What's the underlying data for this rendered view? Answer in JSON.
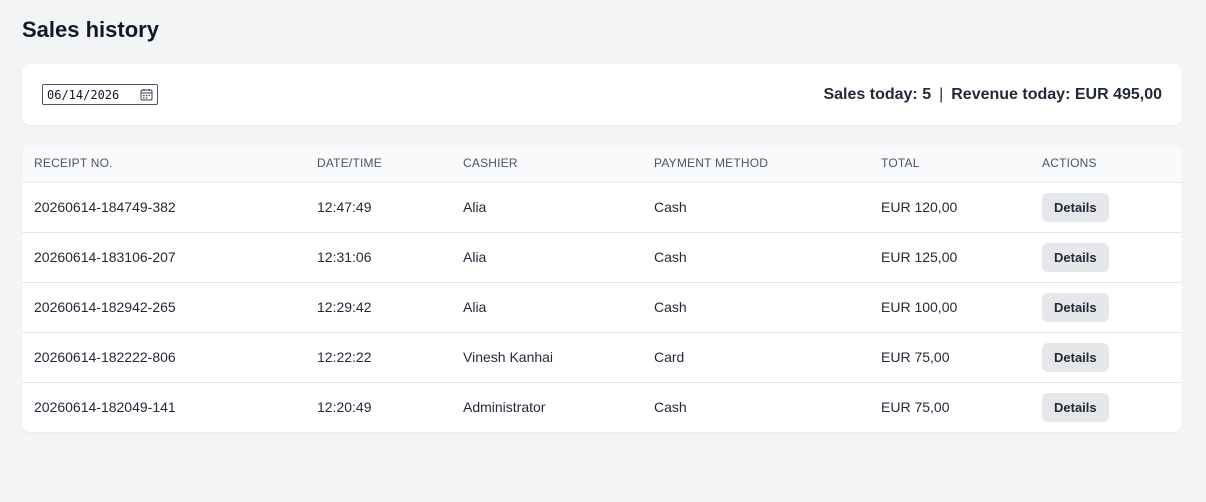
{
  "page": {
    "title": "Sales history"
  },
  "filter": {
    "date_value": "06/14/2026",
    "sales_today_label": "Sales today: 5",
    "separator": "|",
    "revenue_today_label": "Revenue today: EUR 495,00"
  },
  "table": {
    "headers": [
      "RECEIPT NO.",
      "DATE/TIME",
      "CASHIER",
      "PAYMENT METHOD",
      "TOTAL",
      "ACTIONS"
    ],
    "rows": [
      {
        "receipt": "20260614-184749-382",
        "time": "12:47:49",
        "cashier": "Alia",
        "payment": "Cash",
        "total": "EUR 120,00",
        "action": "Details"
      },
      {
        "receipt": "20260614-183106-207",
        "time": "12:31:06",
        "cashier": "Alia",
        "payment": "Cash",
        "total": "EUR 125,00",
        "action": "Details"
      },
      {
        "receipt": "20260614-182942-265",
        "time": "12:29:42",
        "cashier": "Alia",
        "payment": "Cash",
        "total": "EUR 100,00",
        "action": "Details"
      },
      {
        "receipt": "20260614-182222-806",
        "time": "12:22:22",
        "cashier": "Vinesh Kanhai",
        "payment": "Card",
        "total": "EUR 75,00",
        "action": "Details"
      },
      {
        "receipt": "20260614-182049-141",
        "time": "12:20:49",
        "cashier": "Administrator",
        "payment": "Cash",
        "total": "EUR 75,00",
        "action": "Details"
      }
    ]
  },
  "icons": {
    "date_picker": "calendar-icon"
  },
  "colors": {
    "background": "#f3f4f6",
    "card": "#ffffff",
    "button": "#e5e7eb"
  }
}
